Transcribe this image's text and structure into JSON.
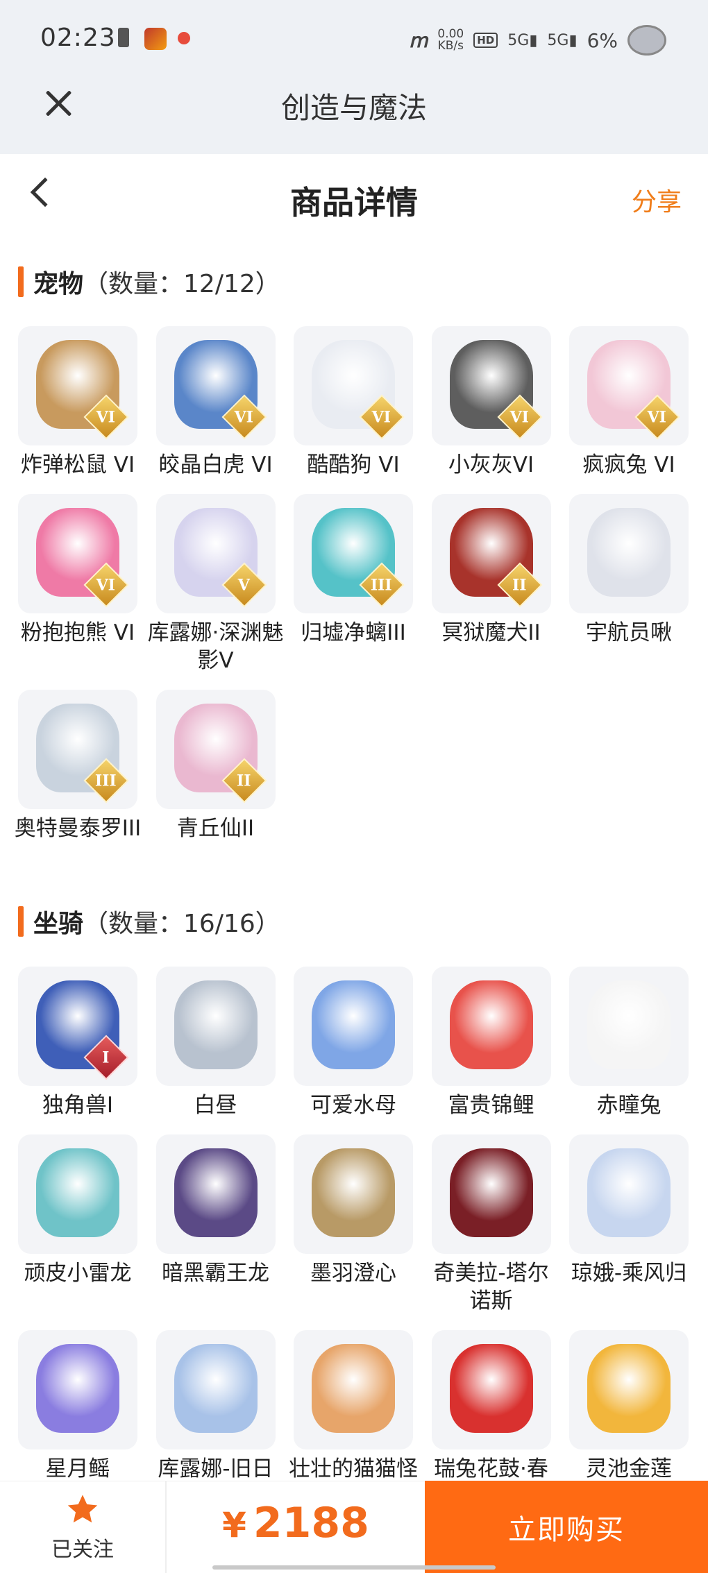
{
  "status_bar": {
    "time": "02:23",
    "net_speed_value": "0.00",
    "net_speed_unit": "KB/s",
    "hd": "HD",
    "signal1": "5G",
    "signal2": "5G",
    "battery": "6%"
  },
  "app_bar": {
    "title": "创造与魔法"
  },
  "page": {
    "title": "商品详情",
    "share_label": "分享"
  },
  "pets": {
    "name": "宠物",
    "count": "（数量：12/12）",
    "items": [
      {
        "name": "炸弹松鼠 VI",
        "badge": "VI",
        "color": "#c89a5e"
      },
      {
        "name": "皎晶白虎 VI",
        "badge": "VI",
        "color": "#5a86c9"
      },
      {
        "name": "酷酷狗 VI",
        "badge": "VI",
        "color": "#e9ecf2"
      },
      {
        "name": "小灰灰VI",
        "badge": "VI",
        "color": "#5e5e5e"
      },
      {
        "name": "疯疯兔 VI",
        "badge": "VI",
        "color": "#f2c7d6"
      },
      {
        "name": "粉抱抱熊 VI",
        "badge": "VI",
        "color": "#ef7aa6"
      },
      {
        "name": "库露娜·深渊魅影V",
        "badge": "V",
        "color": "#d6d3ee"
      },
      {
        "name": "归墟净螭III",
        "badge": "III",
        "color": "#55c2c8"
      },
      {
        "name": "冥狱魔犬II",
        "badge": "II",
        "color": "#a8332b"
      },
      {
        "name": "宇航员啾",
        "badge": "",
        "color": "#dfe2ea"
      },
      {
        "name": "奥特曼泰罗III",
        "badge": "III",
        "color": "#c9d3de"
      },
      {
        "name": "青丘仙II",
        "badge": "II",
        "color": "#eab8d0"
      }
    ]
  },
  "mounts": {
    "name": "坐骑",
    "count": "（数量：16/16）",
    "items": [
      {
        "name": "独角兽I",
        "badge": "I",
        "color": "#3f5fb8"
      },
      {
        "name": "白昼",
        "badge": "",
        "color": "#b8c2cf"
      },
      {
        "name": "可爱水母",
        "badge": "",
        "color": "#7fa6e6"
      },
      {
        "name": "富贵锦鲤",
        "badge": "",
        "color": "#e8524b"
      },
      {
        "name": "赤瞳兔",
        "badge": "",
        "color": "#f5f5f5"
      },
      {
        "name": "顽皮小雷龙",
        "badge": "",
        "color": "#6fc3c8"
      },
      {
        "name": "暗黑霸王龙",
        "badge": "",
        "color": "#5b4a86"
      },
      {
        "name": "墨羽澄心",
        "badge": "",
        "color": "#b89a66"
      },
      {
        "name": "奇美拉-塔尔诺斯",
        "badge": "",
        "color": "#7a1f26"
      },
      {
        "name": "琼娥-乘风归",
        "badge": "",
        "color": "#c7d6ef"
      },
      {
        "name": "星月鳐",
        "badge": "",
        "color": "#8a7de0"
      },
      {
        "name": "库露娜-旧日之歌",
        "badge": "",
        "color": "#a8c2e8"
      },
      {
        "name": "壮壮的猫猫怪",
        "badge": "",
        "color": "#e7a56a"
      },
      {
        "name": "瑞兔花鼓·春",
        "badge": "",
        "color": "#d9312f"
      },
      {
        "name": "灵池金莲",
        "badge": "",
        "color": "#f2b63c"
      }
    ]
  },
  "bottom_bar": {
    "follow_label": "已关注",
    "currency": "¥",
    "price": "2188",
    "buy_label": "立即购买"
  }
}
